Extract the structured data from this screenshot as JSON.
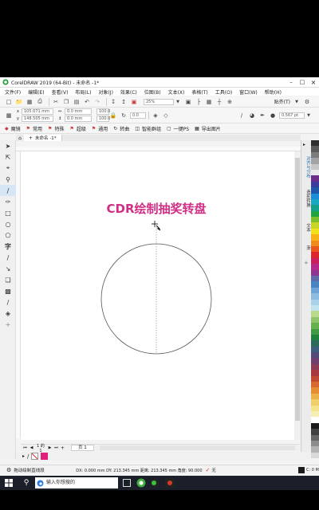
{
  "window": {
    "title": "CorelDRAW 2019 (64-Bit) - 未命名 -1*"
  },
  "menu": [
    "文件(F)",
    "编辑(E)",
    "查看(V)",
    "布局(L)",
    "对象(J)",
    "效果(C)",
    "位图(B)",
    "文本(X)",
    "表格(T)",
    "工具(O)",
    "窗口(W)",
    "帮助(H)"
  ],
  "toolbar": {
    "zoom": "25%",
    "snap_label": "贴齐(T)",
    "outline_width": "0.567 pt"
  },
  "propbar": {
    "x": "105.071 mm",
    "y": "148.505 mm",
    "w": "0.0 mm",
    "h": "0.0 mm",
    "scale_x": "100.0",
    "scale_y": "100.0",
    "angle": "0.0"
  },
  "plugin_bar": [
    "魔镜",
    "常用",
    "特殊",
    "超级",
    "通用",
    "转曲",
    "智能群组",
    "一键PS",
    "导出图片"
  ],
  "tab": {
    "label": "未命名 -1*"
  },
  "canvas": {
    "heading": "CDR绘制抽奖转盘",
    "heading_color": "#d02f86"
  },
  "right_panel_tabs": [
    "对齐与分布",
    "造形转换",
    "文本",
    "渐"
  ],
  "page_nav": {
    "page_label": "页 1"
  },
  "status": {
    "hint": "拖动绘制直线段",
    "coords": "DX:  0.000 mm DY:  213.345 mm 距离:  213.345 mm 角度:  90.000",
    "outline_label": "无",
    "fill_label": "C: 0 M"
  },
  "colors": {
    "accent": "#d02f86",
    "fill_swatch": "#e0207a"
  },
  "taskbar": {
    "search_placeholder": "输入你想搜的"
  },
  "palette": [
    "#2e2e2e",
    "#5a5a5a",
    "#7c7c7c",
    "#a3a3a3",
    "#c7c7c7",
    "#e9e9e9",
    "#6b2d88",
    "#3a3d9a",
    "#1f58a8",
    "#1a8cd8",
    "#19a7c4",
    "#14a089",
    "#23a33b",
    "#7bbf2e",
    "#c8d62a",
    "#f2e21d",
    "#f7b21a",
    "#f08a1c",
    "#e7561e",
    "#d9252b",
    "#c81f5d",
    "#b52a88",
    "#8e3591",
    "#5f6aa8",
    "#4a84c0",
    "#6fa2d5",
    "#8dbbe0",
    "#a9d1e8",
    "#c2e2ee",
    "#b9d98d",
    "#8fc46c",
    "#67b04f",
    "#3f9a43",
    "#1f7f3c",
    "#2b6a5a",
    "#3d5d7a",
    "#53497a",
    "#6e3f6e",
    "#8b3a58",
    "#a53a3f",
    "#c04a33",
    "#d76a2e",
    "#e58d35",
    "#ecb24a",
    "#f0cf6b",
    "#f3e38c",
    "#f6efb5",
    "#ffffff",
    "#1a1a1a",
    "#404040",
    "#666666",
    "#8c8c8c",
    "#b3b3b3",
    "#d9d9d9"
  ]
}
